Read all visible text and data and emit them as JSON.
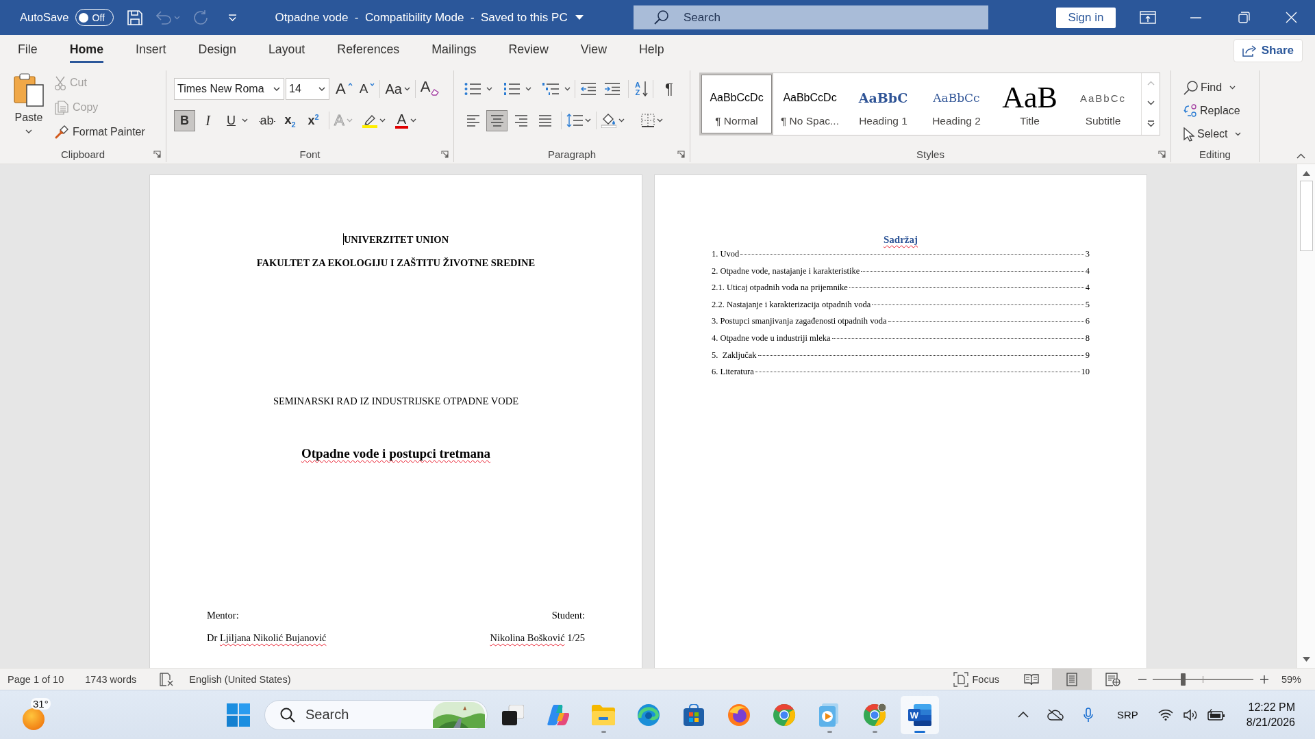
{
  "title_bar": {
    "autosave_label": "AutoSave",
    "autosave": {
      "on": false,
      "label": "Off"
    },
    "quick_access": [
      {
        "kind": "save",
        "disabled": false
      },
      {
        "kind": "undo",
        "disabled": true
      },
      {
        "kind": "redo",
        "disabled": true
      },
      {
        "kind": "customize",
        "disabled": false
      }
    ],
    "title": "Otpadne vode  -  Compatibility Mode  -  Saved to this PC",
    "search": {
      "placeholder": "Search"
    },
    "sign_in": "Sign in"
  },
  "tabs": [
    {
      "label": "File",
      "selected": false
    },
    {
      "label": "Home",
      "selected": true
    },
    {
      "label": "Insert",
      "selected": false
    },
    {
      "label": "Design",
      "selected": false
    },
    {
      "label": "Layout",
      "selected": false
    },
    {
      "label": "References",
      "selected": false
    },
    {
      "label": "Mailings",
      "selected": false
    },
    {
      "label": "Review",
      "selected": false
    },
    {
      "label": "View",
      "selected": false
    },
    {
      "label": "Help",
      "selected": false
    }
  ],
  "share": "Share",
  "ribbon": {
    "clipboard": {
      "label": "Clipboard",
      "paste": "Paste",
      "cut": {
        "label": "Cut",
        "disabled": true
      },
      "copy": {
        "label": "Copy",
        "disabled": true
      },
      "format_painter": {
        "label": "Format Painter",
        "disabled": false
      }
    },
    "font": {
      "label": "Font",
      "font_name": "Times New Roma",
      "font_size": "14",
      "size_tools": [
        {
          "kind": "grow",
          "glyph": "A"
        },
        {
          "kind": "shrink",
          "glyph": "A"
        }
      ],
      "change_case": "Aa",
      "clear_formatting": "A",
      "formats": [
        {
          "kind": "bold",
          "glyph": "B",
          "selected": true
        },
        {
          "kind": "italic",
          "glyph": "I",
          "selected": false
        },
        {
          "kind": "underline",
          "glyph": "U",
          "selected": false
        },
        {
          "kind": "strikethrough",
          "glyph": "ab",
          "selected": false
        },
        {
          "kind": "subscript",
          "glyph": "x$_{2}$",
          "selected": false
        },
        {
          "kind": "superscript",
          "glyph": "x$^{2}$",
          "selected": false
        }
      ],
      "text_effects": "A",
      "font_color": "A"
    },
    "paragraph": {
      "label": "Paragraph",
      "sort": [
        "A",
        "Z"
      ],
      "show_marks": {
        "glyph": "¶",
        "selected": false
      },
      "alignments": [
        {
          "kind": "left",
          "selected": false
        },
        {
          "kind": "center",
          "selected": true
        },
        {
          "kind": "right",
          "selected": false
        },
        {
          "kind": "justify",
          "selected": false
        }
      ]
    },
    "styles": {
      "label": "Styles",
      "items": [
        {
          "kind": "normal",
          "preview": "AaBbCcDc",
          "label": "¶ Normal",
          "selected": true
        },
        {
          "kind": "no_spacing",
          "preview": "AaBbCcDc",
          "label": "¶ No Spac...",
          "selected": false
        },
        {
          "kind": "heading1",
          "preview": "AaBbC",
          "label": "Heading 1",
          "selected": false
        },
        {
          "kind": "heading2",
          "preview": "AaBbCc",
          "label": "Heading 2",
          "selected": false
        },
        {
          "kind": "title",
          "preview": "AaB",
          "label": "Title",
          "selected": false
        },
        {
          "kind": "subtitle",
          "preview": "AaBbCc",
          "label": "Subtitle",
          "selected": false
        }
      ]
    },
    "editing": {
      "label": "Editing",
      "find": "Find",
      "replace": "Replace",
      "select": "Select"
    }
  },
  "pages": [
    {
      "kind": "cover",
      "lines": [
        {
          "kind": "institution",
          "text": "UNIVERZITET UNION",
          "cursor": true,
          "flagged": false
        },
        {
          "kind": "institution",
          "text": "FAKULTET ZA EKOLOGIJU I ZAŠTITU ŽIVOTNE SREDINE",
          "cursor": false,
          "flagged": false
        },
        {
          "kind": "course",
          "text": "SEMINARSKI RAD IZ INDUSTRIJSKE OTPADNE VODE",
          "cursor": false,
          "flagged": false
        },
        {
          "kind": "title",
          "text": "Otpadne vode i postupci tretmana",
          "cursor": false,
          "flagged": true
        }
      ],
      "signatures": [
        {
          "label": "Mentor:",
          "name": [
            {
              "text": "Dr",
              "flagged": false
            },
            {
              "text": "Ljiljana Nikolić Bujanović",
              "flagged": true
            }
          ]
        },
        {
          "label": "Student:",
          "name": [
            {
              "text": "Nikolina Bošković",
              "flagged": true
            },
            {
              "text": "1/25",
              "flagged": false
            }
          ]
        }
      ]
    },
    {
      "kind": "toc",
      "title": "Sadržaj",
      "title_flagged": true,
      "entries": [
        {
          "text": "1. Uvod",
          "page": "3"
        },
        {
          "text": "2. Otpadne vode, nastajanje i karakteristike",
          "page": "4"
        },
        {
          "text": "2.1. Uticaj otpadnih voda na prijemnike",
          "page": "4"
        },
        {
          "text": "2.2. Nastajanje i karakterizacija otpadnih voda",
          "page": "5"
        },
        {
          "text": "3. Postupci smanjivanja zagađenosti otpadnih voda",
          "page": "6"
        },
        {
          "text": "4. Otpadne vode u industriji mleka",
          "page": "8"
        },
        {
          "text": "5.  Zaključak",
          "page": "9"
        },
        {
          "text": "6. Literatura",
          "page": "10"
        }
      ]
    }
  ],
  "status_bar": {
    "page": "Page 1 of 10",
    "words": "1743 words",
    "language": "English (United States)",
    "focus": "Focus",
    "views": [
      {
        "kind": "read",
        "selected": false
      },
      {
        "kind": "print",
        "selected": true
      },
      {
        "kind": "web",
        "selected": false
      }
    ],
    "zoom": {
      "level": 0.3,
      "reading": "59%"
    }
  },
  "taskbar": {
    "weather": "31°",
    "search": {
      "placeholder": "Search"
    },
    "apps": [
      {
        "kind": "task_view",
        "running": false,
        "selected": false
      },
      {
        "kind": "copilot",
        "running": false,
        "selected": false
      },
      {
        "kind": "file_explorer",
        "running": true,
        "selected": false
      },
      {
        "kind": "edge",
        "running": false,
        "selected": false
      },
      {
        "kind": "store",
        "running": false,
        "selected": false
      },
      {
        "kind": "firefox",
        "running": false,
        "selected": false
      },
      {
        "kind": "chrome",
        "running": false,
        "selected": false
      },
      {
        "kind": "media_player",
        "running": true,
        "selected": false
      },
      {
        "kind": "chrome_profile",
        "running": true,
        "selected": false
      },
      {
        "kind": "word",
        "glyph": "W",
        "running": true,
        "selected": true
      }
    ],
    "tray": {
      "language": "SRP",
      "time": "12:22 PM",
      "date": "8/21/2026"
    }
  }
}
